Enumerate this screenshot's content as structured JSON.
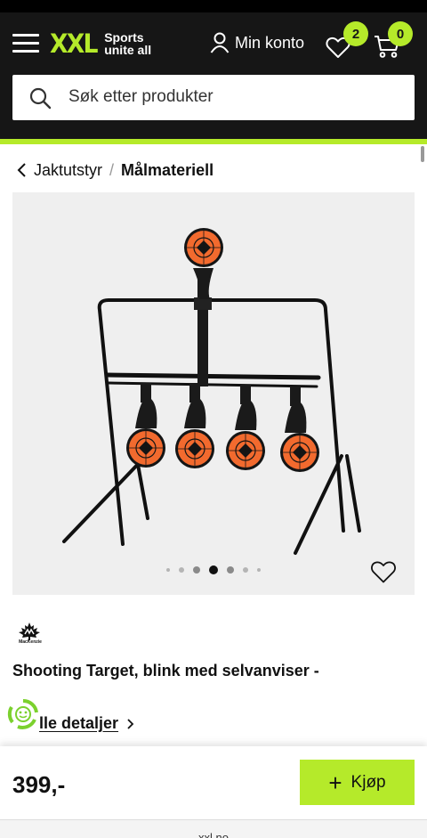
{
  "header": {
    "logo_main": "XXL",
    "logo_tag_line1": "Sports",
    "logo_tag_line2": "unite all",
    "account_label": "Min konto",
    "wishlist_count": "2",
    "cart_count": "0",
    "accent_color": "#b5ea2a",
    "background_color": "#161616"
  },
  "search": {
    "placeholder": "Søk etter produkter"
  },
  "breadcrumb": {
    "parent": "Jaktutstyr",
    "separator": "/",
    "current": "Målmateriell"
  },
  "gallery": {
    "image_count": 7,
    "active_index": 3,
    "target_color": "#f26a2e"
  },
  "product": {
    "brand": "MacKenzie",
    "title": "Shooting Target, blink med selvanviser -",
    "details_link": "Alle detaljer",
    "details_link_visible": "lle detaljer"
  },
  "purchase": {
    "price": "399,-",
    "buy_label": "Kjøp",
    "buy_icon": "plus-icon"
  },
  "browser": {
    "url": "xxl.no"
  }
}
